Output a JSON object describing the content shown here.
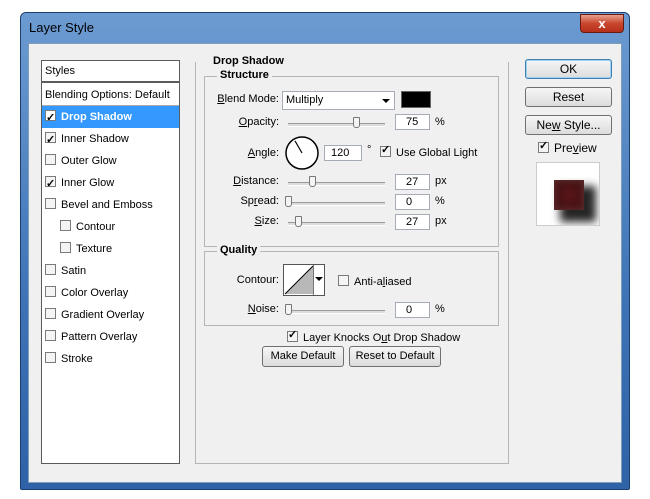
{
  "window": {
    "title": "Layer Style",
    "close_label": "x"
  },
  "styles_panel": {
    "header": "Styles",
    "items": [
      {
        "label": "Blending Options: Default",
        "has_checkbox": false,
        "checked": false,
        "selected": false,
        "indent": false
      },
      {
        "label": "Drop Shadow",
        "has_checkbox": true,
        "checked": true,
        "selected": true,
        "indent": false
      },
      {
        "label": "Inner Shadow",
        "has_checkbox": true,
        "checked": true,
        "selected": false,
        "indent": false
      },
      {
        "label": "Outer Glow",
        "has_checkbox": true,
        "checked": false,
        "selected": false,
        "indent": false
      },
      {
        "label": "Inner Glow",
        "has_checkbox": true,
        "checked": true,
        "selected": false,
        "indent": false
      },
      {
        "label": "Bevel and Emboss",
        "has_checkbox": true,
        "checked": false,
        "selected": false,
        "indent": false
      },
      {
        "label": "Contour",
        "has_checkbox": true,
        "checked": false,
        "selected": false,
        "indent": true
      },
      {
        "label": "Texture",
        "has_checkbox": true,
        "checked": false,
        "selected": false,
        "indent": true
      },
      {
        "label": "Satin",
        "has_checkbox": true,
        "checked": false,
        "selected": false,
        "indent": false
      },
      {
        "label": "Color Overlay",
        "has_checkbox": true,
        "checked": false,
        "selected": false,
        "indent": false
      },
      {
        "label": "Gradient Overlay",
        "has_checkbox": true,
        "checked": false,
        "selected": false,
        "indent": false
      },
      {
        "label": "Pattern Overlay",
        "has_checkbox": true,
        "checked": false,
        "selected": false,
        "indent": false
      },
      {
        "label": "Stroke",
        "has_checkbox": true,
        "checked": false,
        "selected": false,
        "indent": false
      }
    ]
  },
  "drop_shadow": {
    "section_title": "Drop Shadow",
    "structure": {
      "title": "Structure",
      "blend_mode_label": "Blend Mode:",
      "blend_mode_value": "Multiply",
      "shadow_color": "#000000",
      "opacity_label": "Opacity:",
      "opacity_value": "75",
      "opacity_unit": "%",
      "opacity_fraction": 0.75,
      "angle_label": "Angle:",
      "angle_value": "120",
      "angle_unit": "°",
      "use_global_light_label": "Use Global Light",
      "use_global_light": true,
      "distance_label": "Distance:",
      "distance_value": "27",
      "distance_unit": "px",
      "distance_fraction": 0.27,
      "spread_label": "Spread:",
      "spread_value": "0",
      "spread_unit": "%",
      "spread_fraction": 0,
      "size_label": "Size:",
      "size_value": "27",
      "size_unit": "px",
      "size_fraction": 0.11
    },
    "quality": {
      "title": "Quality",
      "contour_label": "Contour:",
      "anti_aliased_label": "Anti-aliased",
      "anti_aliased": false,
      "noise_label": "Noise:",
      "noise_value": "0",
      "noise_unit": "%",
      "noise_fraction": 0
    },
    "knocks_out_label": "Layer Knocks Out Drop Shadow",
    "knocks_out": true,
    "make_default_label": "Make Default",
    "reset_default_label": "Reset to Default"
  },
  "buttons": {
    "ok": "OK",
    "reset": "Reset",
    "new_style": "New Style...",
    "preview_label": "Preview",
    "preview": true
  }
}
